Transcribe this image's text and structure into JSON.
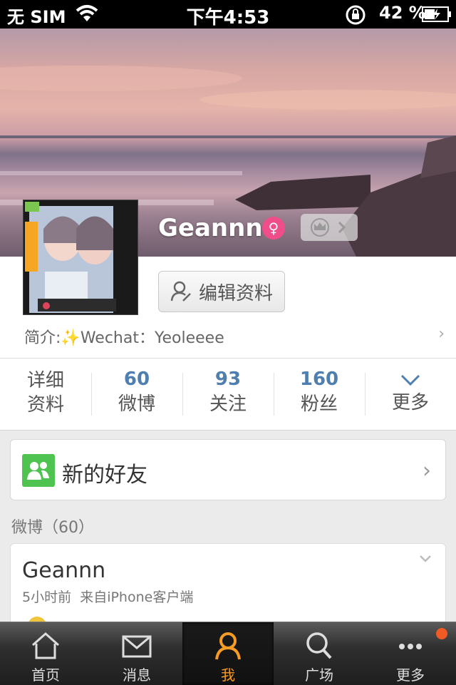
{
  "status_bar": {
    "carrier": "无 SIM",
    "time": "下午4:53",
    "battery": "42 %"
  },
  "profile": {
    "username": "Geannn",
    "gender_icon": "female-symbol-icon",
    "vip_icon": "crown-icon",
    "edit_label": "编辑资料",
    "bio_prefix": "简介:",
    "bio_sparkle": "✨",
    "bio_text": "Wechat：Yeoleeee"
  },
  "stats": {
    "details": {
      "line1": "详细",
      "line2": "资料"
    },
    "weibo": {
      "count": "60",
      "label": "微博"
    },
    "following": {
      "count": "93",
      "label": "关注"
    },
    "fans": {
      "count": "160",
      "label": "粉丝"
    },
    "more": {
      "label": "更多"
    }
  },
  "friends": {
    "label": "新的好友"
  },
  "section": {
    "title": "微博（60）"
  },
  "post": {
    "author": "Geannn",
    "time": "5小时前",
    "source": "来自iPhone客户端"
  },
  "tabbar": {
    "tabs": [
      {
        "label": "首页",
        "icon": "home-icon"
      },
      {
        "label": "消息",
        "icon": "envelope-icon"
      },
      {
        "label": "我",
        "icon": "person-icon"
      },
      {
        "label": "广场",
        "icon": "search-icon"
      },
      {
        "label": "更多",
        "icon": "more-dots-icon"
      }
    ],
    "active_color": "#f69b24"
  },
  "colors": {
    "stat_number": "#4f7fae",
    "friends_icon": "#4fc34f",
    "badge": "#f05a24",
    "gender": "#ef4e8a"
  }
}
